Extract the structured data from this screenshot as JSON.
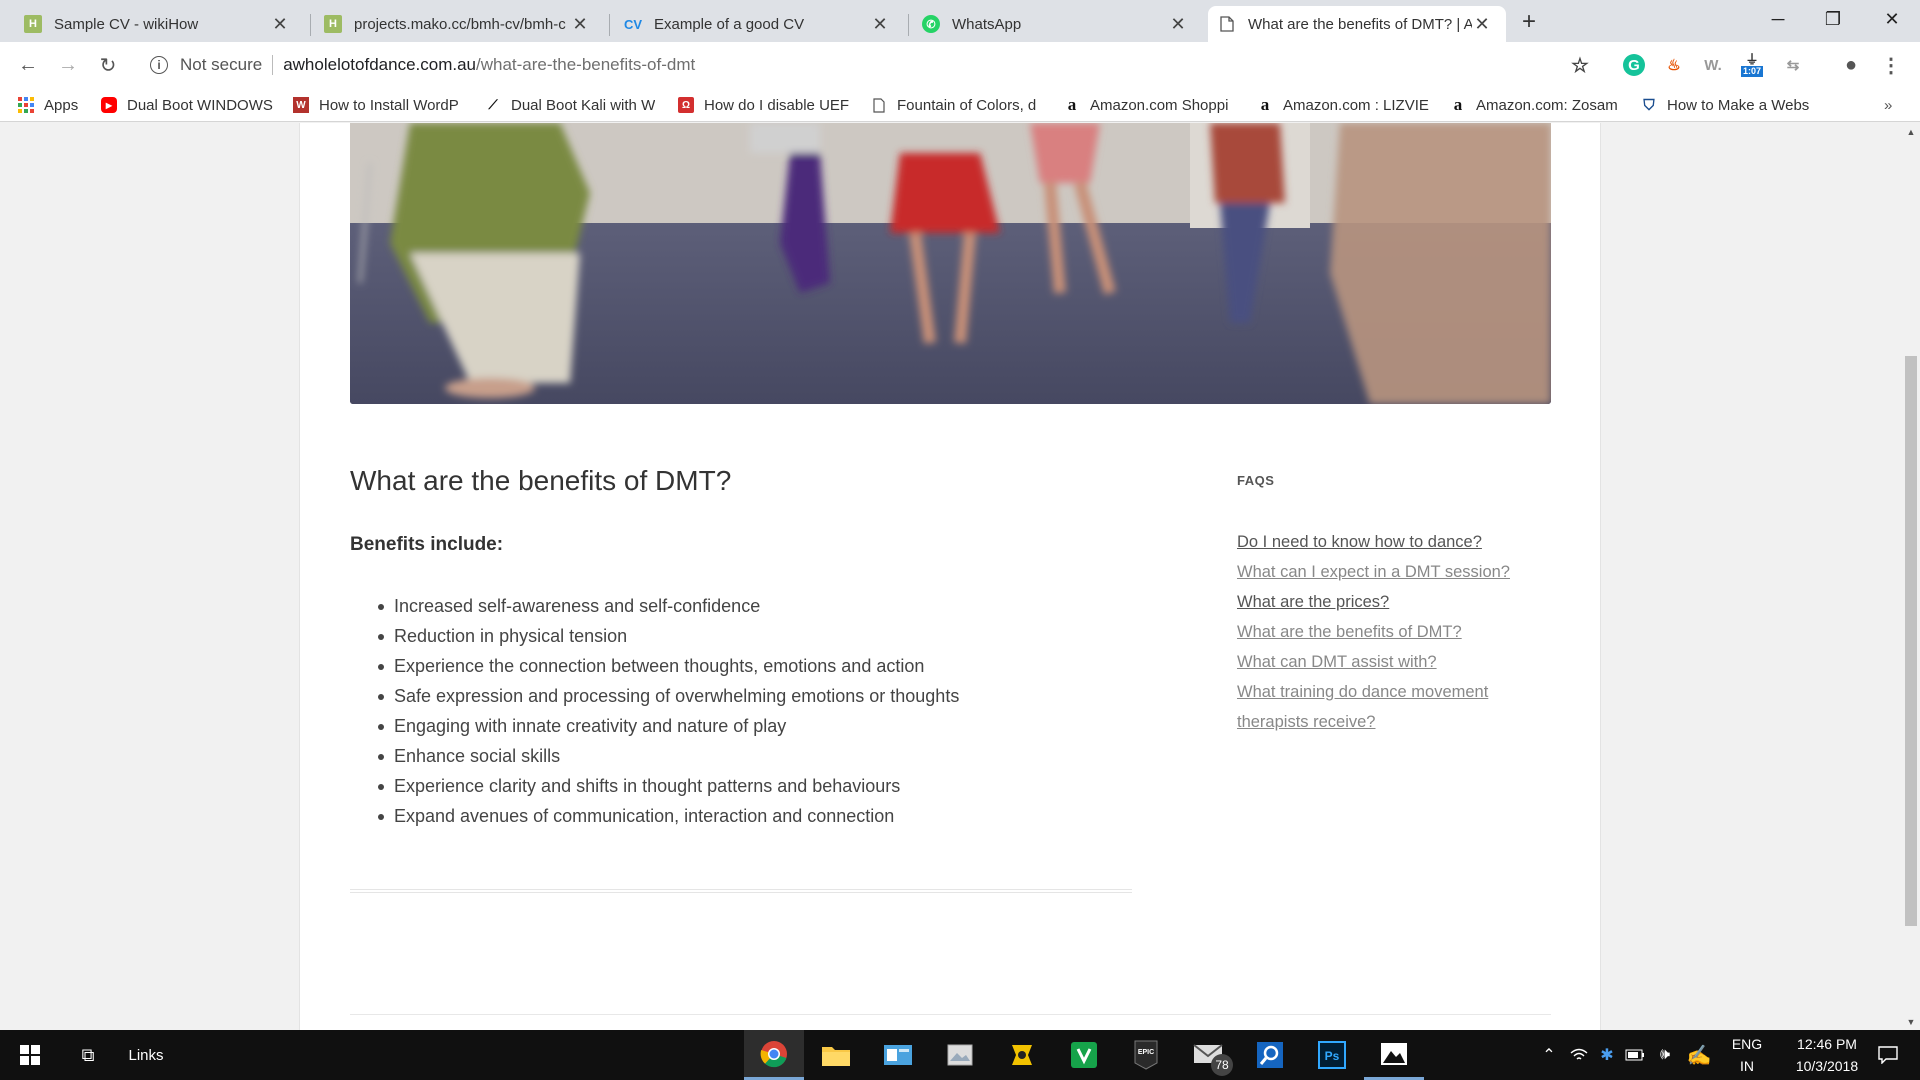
{
  "tabs": [
    {
      "title": "Sample CV - wikiHow",
      "icon": "wikihow-icon"
    },
    {
      "title": "projects.mako.cc/bmh-cv/bmh-c",
      "icon": "wikihow-icon"
    },
    {
      "title": "Example of a good CV",
      "icon": "cv-icon"
    },
    {
      "title": "WhatsApp",
      "icon": "whatsapp-icon"
    },
    {
      "title": "What are the benefits of DMT? | A",
      "icon": "page-icon"
    }
  ],
  "omnibox": {
    "security": "Not secure",
    "host": "awholelotofdance.com.au",
    "path": "/what-are-the-benefits-of-dmt"
  },
  "extensions": {
    "badge_time": "1:07"
  },
  "bookmarks": [
    {
      "label": "Apps",
      "icon": "apps-icon"
    },
    {
      "label": "Dual Boot WINDOWS",
      "icon": "youtube-icon"
    },
    {
      "label": "How to Install WordP",
      "icon": "wikihow-icon"
    },
    {
      "label": "Dual Boot Kali with W",
      "icon": "kali-icon"
    },
    {
      "label": "How do I disable UEF",
      "icon": "bookmark-icon"
    },
    {
      "label": "Fountain of Colors, d",
      "icon": "page-icon"
    },
    {
      "label": "Amazon.com Shoppi",
      "icon": "amazon-icon"
    },
    {
      "label": "Amazon.com : LIZVIE",
      "icon": "amazon-icon"
    },
    {
      "label": "Amazon.com: Zosam",
      "icon": "amazon-icon"
    },
    {
      "label": "How to Make a Webs",
      "icon": "shield-icon"
    }
  ],
  "article": {
    "title": "What are the benefits of DMT?",
    "benefits_heading": "Benefits include:",
    "benefits": [
      "Increased self-awareness and self-confidence",
      "Reduction in physical tension",
      "Experience the connection between thoughts, emotions and action",
      "Safe expression and processing of overwhelming emotions or thoughts",
      "Engaging with innate creativity and nature of play",
      "Enhance social skills",
      "Experience clarity and shifts in thought patterns and behaviours",
      "Expand avenues of communication, interaction and connection"
    ]
  },
  "sidebar": {
    "title": "FAQS",
    "links": [
      "Do I need to know how to dance?",
      "What can I expect in a DMT session?",
      "What are the prices?",
      "What are the benefits of DMT?",
      "What can DMT assist with?",
      "What training do dance movement therapists receive?"
    ]
  },
  "taskbar": {
    "links_label": "Links",
    "mail_badge": "78",
    "lang": "ENG",
    "region": "IN",
    "time": "12:46 PM",
    "date": "10/3/2018"
  },
  "colors": {
    "link": "#888888",
    "link_visited": "#555555",
    "tabstrip": "#dee1e6",
    "taskbar": "#101010"
  }
}
